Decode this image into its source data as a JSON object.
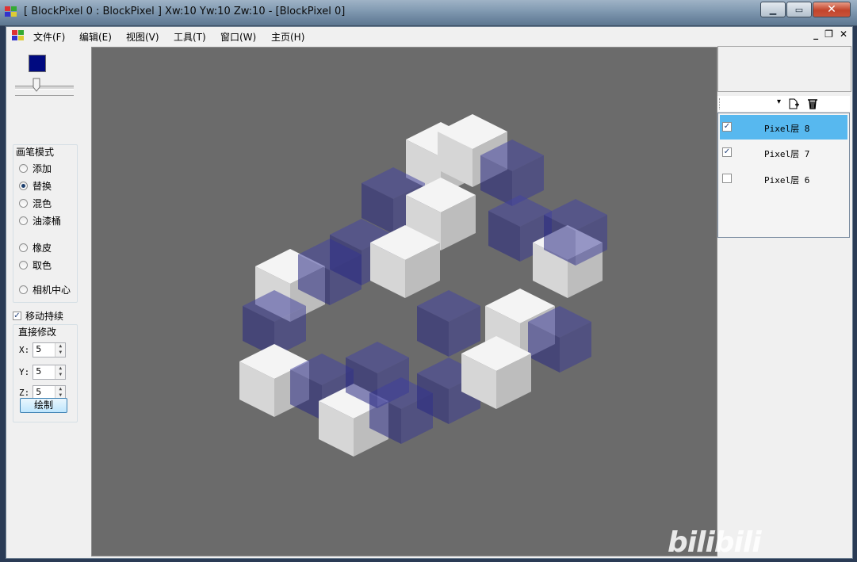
{
  "window": {
    "title": "[ BlockPixel 0 : BlockPixel ]  Xw:10 Yw:10 Zw:10 - [BlockPixel 0]",
    "minimize_glyph": "▁",
    "maximize_glyph": "▭",
    "close_glyph": "✕"
  },
  "menu": {
    "items": [
      "文件(F)",
      "编辑(E)",
      "视图(V)",
      "工具(T)",
      "窗口(W)",
      "主页(H)"
    ],
    "mdi_minimize": "_",
    "mdi_restore": "❐",
    "mdi_close": "✕"
  },
  "left_panel": {
    "color_swatch": "#000a80",
    "brush_mode": {
      "label": "画笔模式",
      "options": [
        {
          "label": "添加",
          "selected": false
        },
        {
          "label": "替换",
          "selected": true
        },
        {
          "label": "混色",
          "selected": false
        },
        {
          "label": "油漆桶",
          "selected": false
        },
        {
          "label": "橡皮",
          "selected": false
        },
        {
          "label": "取色",
          "selected": false
        },
        {
          "label": "相机中心",
          "selected": false
        }
      ]
    },
    "move_continue": {
      "label": "移动持续",
      "checked": true
    },
    "direct_edit": {
      "label": "直接修改",
      "x_label": "X:",
      "x_value": "5",
      "y_label": "Y:",
      "y_value": "5",
      "z_label": "Z:",
      "z_value": "5",
      "draw_button": "绘制"
    }
  },
  "right_panel": {
    "layers": [
      {
        "label": "Pixel层 8",
        "checked": true,
        "selected": true
      },
      {
        "label": "Pixel层 7",
        "checked": true,
        "selected": false
      },
      {
        "label": "Pixel层 6",
        "checked": false,
        "selected": false
      }
    ],
    "check_glyph": "✓"
  },
  "viewport": {
    "background": "#6b6b6b",
    "block_colors": {
      "white": "#e8e8e8",
      "blue": "#3a3a9a"
    }
  },
  "watermark": "bilibili"
}
